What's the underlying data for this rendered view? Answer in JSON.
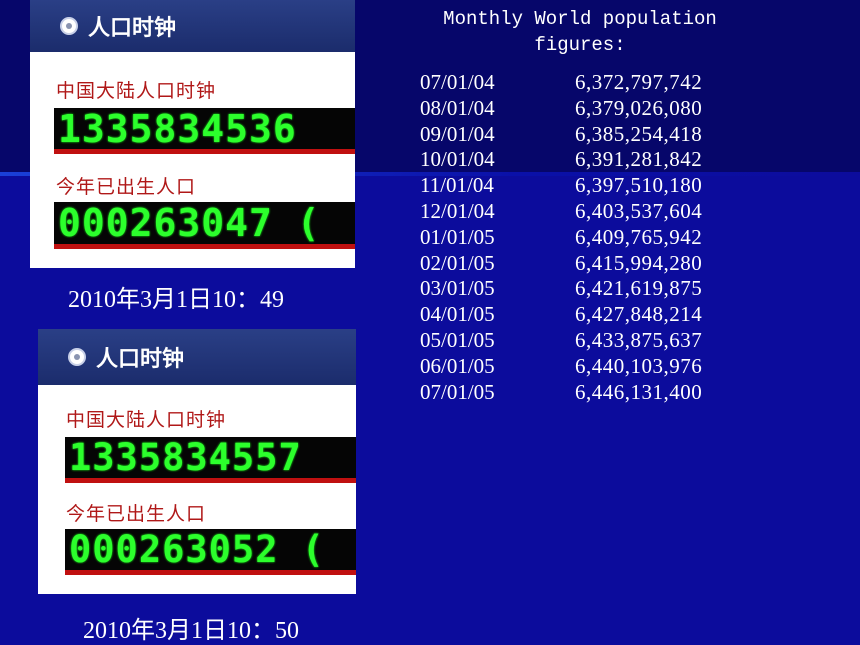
{
  "widgets": [
    {
      "header": "人口时钟",
      "mainland_label": "中国大陆人口时钟",
      "mainland_digits": "1335834536",
      "births_label": "今年已出生人口",
      "births_digits": "000263047 (",
      "caption": "2010年3月1日10：49"
    },
    {
      "header": "人口时钟",
      "mainland_label": "中国大陆人口时钟",
      "mainland_digits": "1335834557",
      "births_label": "今年已出生人口",
      "births_digits": "000263052 (",
      "caption": "2010年3月1日10：50"
    }
  ],
  "population": {
    "title": "Monthly World population figures:",
    "rows": [
      {
        "date": "07/01/04",
        "value": "6,372,797,742"
      },
      {
        "date": "08/01/04",
        "value": "6,379,026,080"
      },
      {
        "date": "09/01/04",
        "value": "6,385,254,418"
      },
      {
        "date": "10/01/04",
        "value": "6,391,281,842"
      },
      {
        "date": "11/01/04",
        "value": "6,397,510,180"
      },
      {
        "date": "12/01/04",
        "value": "6,403,537,604"
      },
      {
        "date": "01/01/05",
        "value": "6,409,765,942"
      },
      {
        "date": "02/01/05",
        "value": "6,415,994,280"
      },
      {
        "date": "03/01/05",
        "value": "6,421,619,875"
      },
      {
        "date": "04/01/05",
        "value": "6,427,848,214"
      },
      {
        "date": "05/01/05",
        "value": "6,433,875,637"
      },
      {
        "date": "06/01/05",
        "value": "6,440,103,976"
      },
      {
        "date": "07/01/05",
        "value": "6,446,131,400"
      }
    ]
  }
}
